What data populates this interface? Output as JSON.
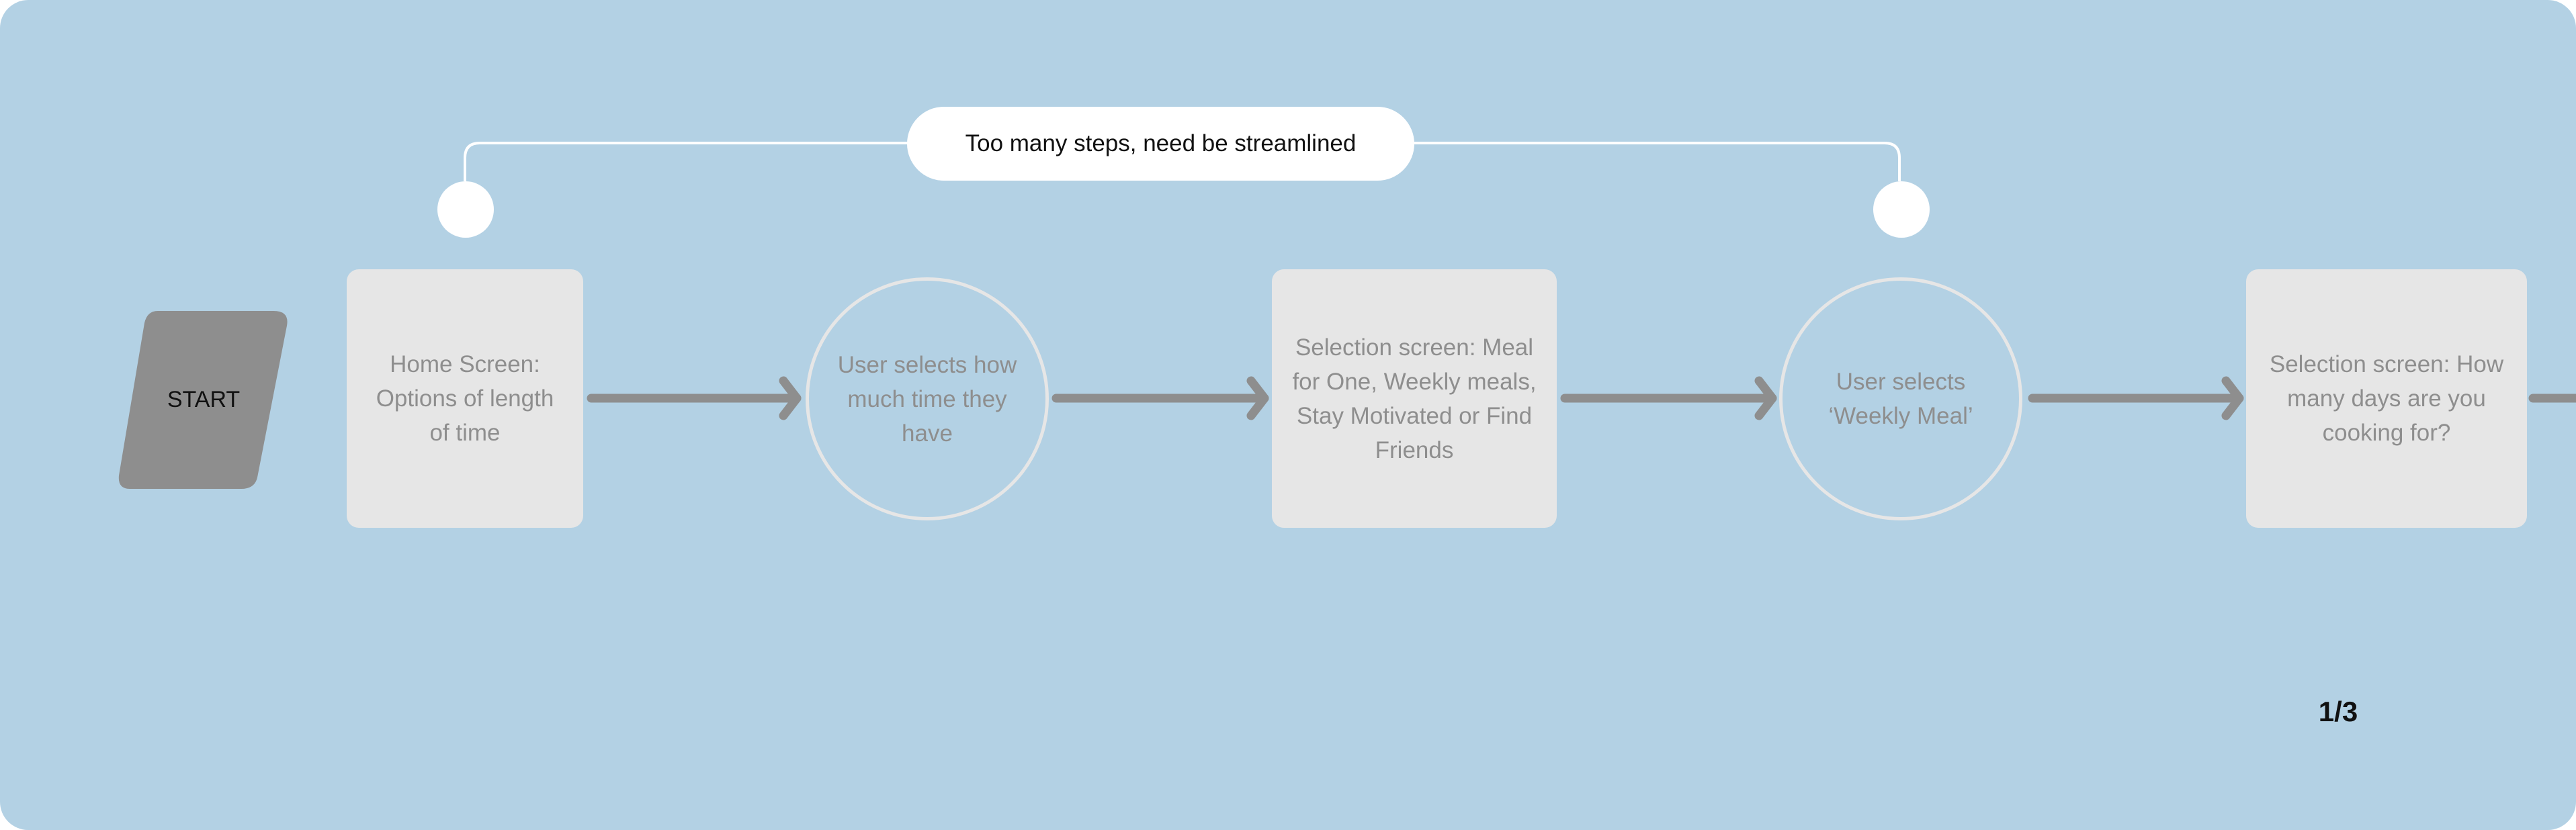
{
  "diagram": {
    "start_label": "START",
    "callout_text": "Too many steps, need be streamlined",
    "page_indicator": "1/3",
    "nodes": [
      {
        "id": "home-screen",
        "shape": "rectangle",
        "text": "Home Screen: Options of length of time"
      },
      {
        "id": "user-selects-time",
        "shape": "circle",
        "text": "User selects how much time they have"
      },
      {
        "id": "selection-screen-mode",
        "shape": "rectangle",
        "text": "Selection screen: Meal for One, Weekly meals, Stay Motivated or Find Friends"
      },
      {
        "id": "user-selects-weekly",
        "shape": "circle",
        "text": "User selects ‘Weekly Meal’"
      },
      {
        "id": "selection-screen-days",
        "shape": "rectangle",
        "text": "Selection screen: How many days are you cooking for?"
      }
    ],
    "edges": [
      {
        "from": "home-screen",
        "to": "user-selects-time"
      },
      {
        "from": "user-selects-time",
        "to": "selection-screen-mode"
      },
      {
        "from": "selection-screen-mode",
        "to": "user-selects-weekly"
      },
      {
        "from": "user-selects-weekly",
        "to": "selection-screen-days"
      },
      {
        "from": "selection-screen-days",
        "to": "next-page"
      }
    ],
    "colors": {
      "background": "#b3d1e4",
      "node_fill": "#e6e6e6",
      "node_text": "#8e8e8e",
      "arrow": "#8e8e8e",
      "start_fill": "#8e8e8e",
      "annotation": "#ffffff"
    }
  }
}
